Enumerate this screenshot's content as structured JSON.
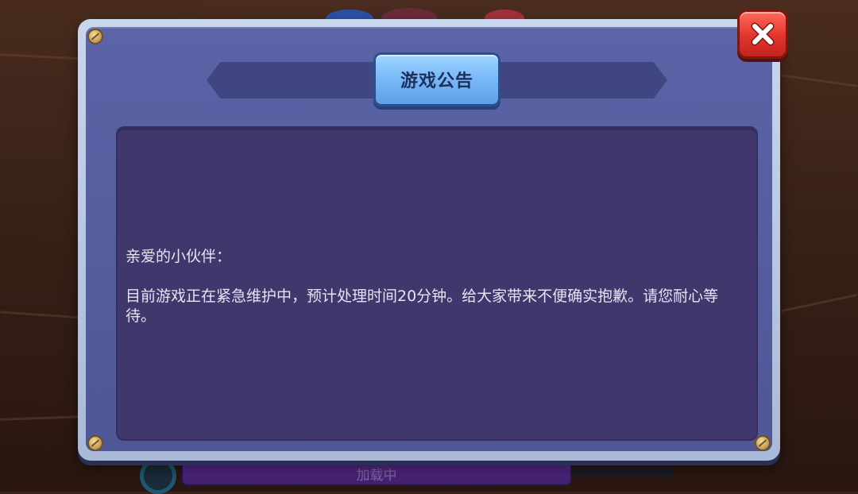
{
  "dialog": {
    "title": "游戏公告",
    "greeting": "亲爱的小伙伴：",
    "message": "目前游戏正在紧急维护中，预计处理时间20分钟。给大家带来不便确实抱歉。请您耐心等待。"
  },
  "loading": {
    "label": "加载中"
  },
  "icons": {
    "close": "close-icon"
  },
  "colors": {
    "frame": "#aab9d7",
    "panel": "#40386d",
    "title_tab": "#78b8f7",
    "close_button": "#e2352c",
    "loading_bar": "#4a2478"
  }
}
